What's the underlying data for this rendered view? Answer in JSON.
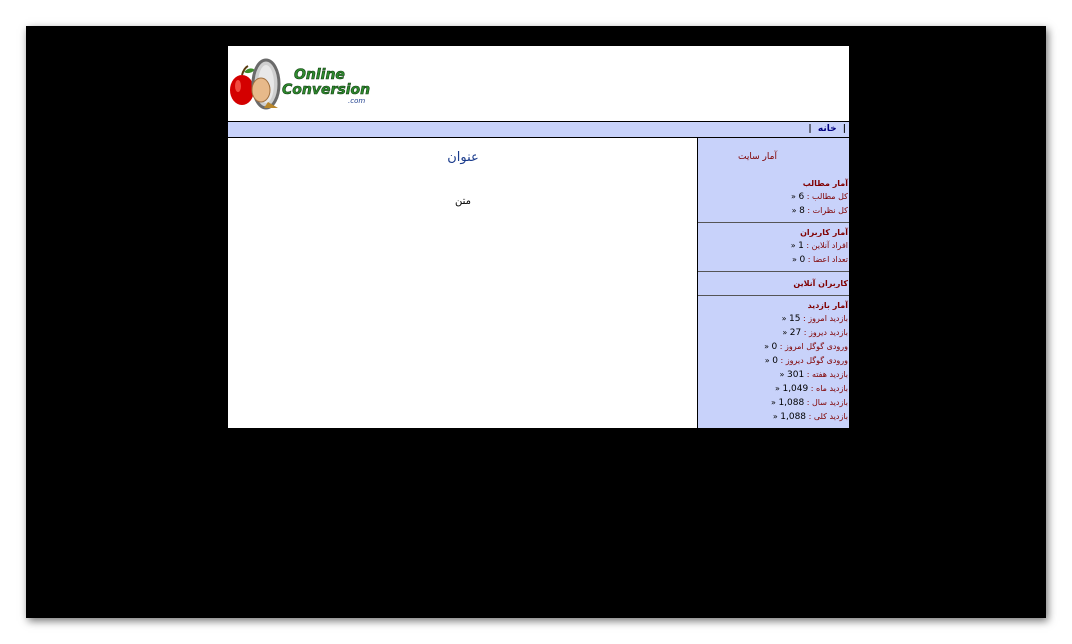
{
  "logo": {
    "line1": "Online",
    "line2": "Conversion",
    "suffix": ".com",
    "colors": {
      "apple": "#d40000",
      "text_green": "#2e8b2e",
      "text_blue": "#1a3b8c"
    }
  },
  "navbar": {
    "sep_left": "|",
    "home_label": "خانه",
    "sep_right": "|"
  },
  "content": {
    "title": "عنوان",
    "text": "متن"
  },
  "sidebar": {
    "heading": "آمار سایت",
    "posts": {
      "title": "آمار مطالب",
      "items": [
        {
          "label": "کل مطالب : ",
          "value": "6"
        },
        {
          "label": "کل نظرات : ",
          "value": "8"
        }
      ]
    },
    "users": {
      "title": "آمار کاربران",
      "items": [
        {
          "label": "افراد آنلاین : ",
          "value": "1"
        },
        {
          "label": "تعداد اعضا : ",
          "value": "0"
        }
      ]
    },
    "online": {
      "title": "کاربران آنلاین"
    },
    "visits": {
      "title": "آمار بازدید",
      "items": [
        {
          "label": "بازدید امروز : ",
          "value": "15"
        },
        {
          "label": "بازدید دیروز : ",
          "value": "27"
        },
        {
          "label": "ورودی گوگل امروز : ",
          "value": "0"
        },
        {
          "label": "ورودی گوگل دیروز : ",
          "value": "0"
        },
        {
          "label": "بازدید هفته : ",
          "value": "301"
        },
        {
          "label": "بازدید ماه : ",
          "value": "1,049"
        },
        {
          "label": "بازدید سال : ",
          "value": "1,088"
        },
        {
          "label": "بازدید کلی : ",
          "value": "1,088"
        }
      ]
    },
    "arrow": "«"
  }
}
